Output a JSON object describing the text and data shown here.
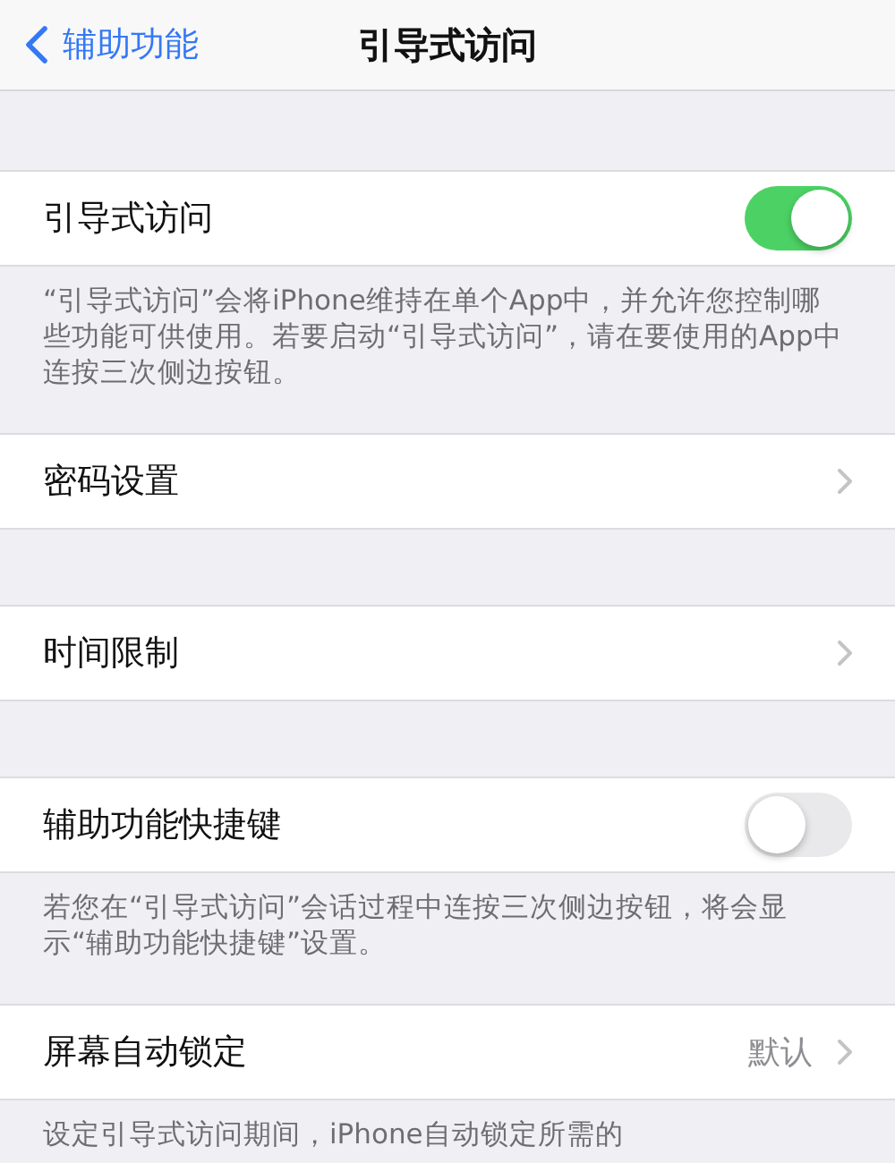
{
  "nav": {
    "back": "辅助功能",
    "title": "引导式访问"
  },
  "sections": [
    {
      "row": {
        "kind": "toggle",
        "label": "引导式访问",
        "on": true
      },
      "footer": "“引导式访问”会将iPhone维持在单个App中，并允许您控制哪些功能可供使用。若要启动“引导式访问”，请在要使用的App中连按三次侧边按钮。"
    },
    {
      "row": {
        "kind": "link",
        "label": "密码设置"
      }
    },
    {
      "row": {
        "kind": "link",
        "label": "时间限制"
      }
    },
    {
      "row": {
        "kind": "toggle",
        "label": "辅助功能快捷键",
        "on": false
      },
      "footer": "若您在“引导式访问”会话过程中连按三次侧边按钮，将会显示“辅助功能快捷键”设置。"
    },
    {
      "row": {
        "kind": "link",
        "label": "屏幕自动锁定",
        "value": "默认"
      },
      "footer": "设定引导式访问期间，iPhone自动锁定所需的"
    }
  ]
}
